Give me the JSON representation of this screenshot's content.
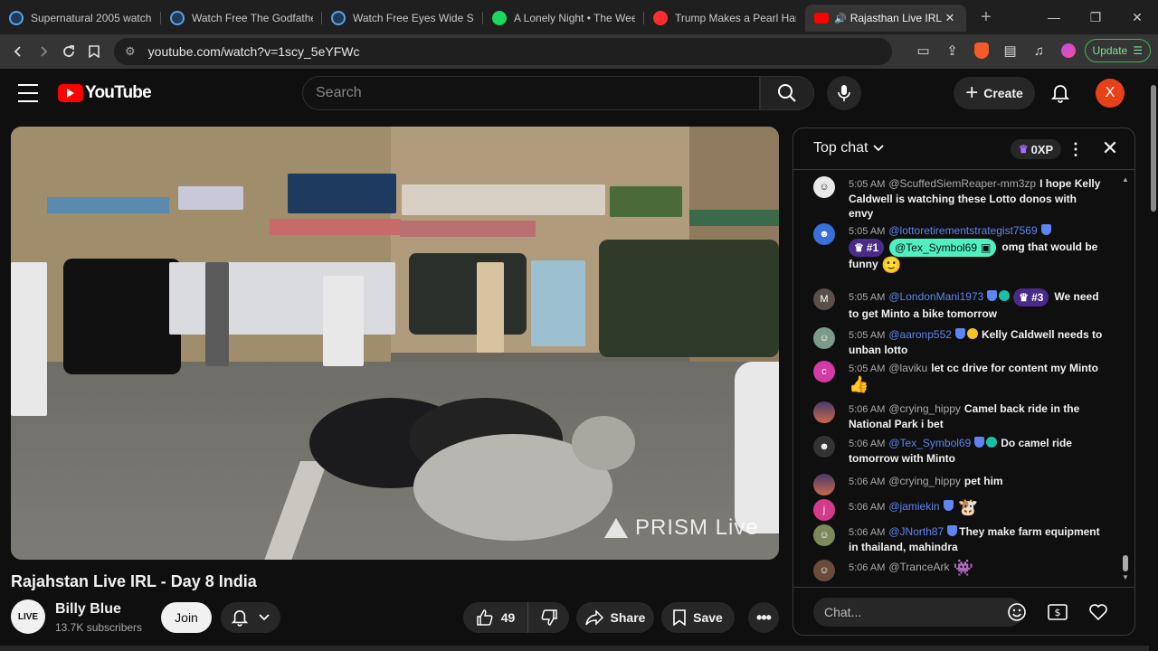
{
  "browser": {
    "tabs": [
      {
        "title": "Supernatural 2005 watch f",
        "favicon": "site-icon",
        "active": false
      },
      {
        "title": "Watch Free The Godfather",
        "favicon": "site-icon",
        "active": false
      },
      {
        "title": "Watch Free Eyes Wide Shu",
        "favicon": "site-icon",
        "active": false
      },
      {
        "title": "A Lonely Night • The Week",
        "favicon": "spotify-icon",
        "active": false
      },
      {
        "title": "Trump Makes a Pearl Harb",
        "favicon": "youtube-icon",
        "active": false
      },
      {
        "title": "Rajasthan Live IRL -",
        "favicon": "youtube-icon",
        "active": true
      }
    ],
    "url": "youtube.com/watch?v=1scy_5eYFWc",
    "update_label": "Update"
  },
  "youtube": {
    "logo_text": "YouTube",
    "search_placeholder": "Search",
    "create_label": "Create",
    "avatar_letter": "X"
  },
  "video": {
    "watermark": "PRISM Live",
    "title": "Rajahstan Live IRL - Day 8 India",
    "channel": "Billy Blue",
    "channel_avatar_text": "LIVE",
    "subscribers": "13.7K subscribers",
    "join_label": "Join",
    "likes": "49",
    "share_label": "Share",
    "save_label": "Save"
  },
  "chat": {
    "header": "Top chat",
    "xp": "0XP",
    "input_placeholder": "Chat...",
    "messages": [
      {
        "time": "5:05 AM",
        "author": "@ScuffedSiemReaper-mm3zp",
        "text": "I hope Kelly Caldwell is watching these Lotto donos with envy",
        "avatar_color": "#e8e8e8"
      },
      {
        "time": "5:05 AM",
        "author": "@lottoretirementstrategist7569",
        "rank": "#1",
        "mention": "@Tex_Symbol69",
        "text": "omg that would be funny",
        "emoji": "🙂",
        "avatar_color": "#3a6fd8"
      },
      {
        "time": "5:05 AM",
        "author": "@LondonMani1973",
        "rank": "#3",
        "text": "We need to get Minto a bike tomorrow",
        "avatar_letter": "M",
        "avatar_color": "#5a4f4a"
      },
      {
        "time": "5:05 AM",
        "author": "@aaronp552",
        "text": "Kelly Caldwell needs to unban lotto",
        "avatar_color": "#7a9a8a"
      },
      {
        "time": "5:05 AM",
        "author": "@laviku",
        "text": "let cc drive for content my Minto",
        "emoji": "👍",
        "avatar_letter": "c",
        "avatar_color": "#d43aa5"
      },
      {
        "time": "5:06 AM",
        "author": "@crying_hippy",
        "text": "Camel back ride in the National Park i bet",
        "avatar_color": "#8a6a9a"
      },
      {
        "time": "5:06 AM",
        "author": "@Tex_Symbol69",
        "text": "Do camel ride tomorrow with Minto",
        "avatar_color": "#333333"
      },
      {
        "time": "5:06 AM",
        "author": "@crying_hippy",
        "text": "pet him",
        "avatar_color": "#8a6a9a"
      },
      {
        "time": "5:06 AM",
        "author": "@jamiekin",
        "text": "",
        "emoji": "🐮",
        "avatar_letter": "j",
        "avatar_color": "#d43a8a"
      },
      {
        "time": "5:06 AM",
        "author": "@JNorth87",
        "text": "They make farm equipment in thailand, mahindra",
        "avatar_color": "#7a8a5a"
      },
      {
        "time": "5:06 AM",
        "author": "@TranceArk",
        "text": "",
        "emoji": "👾",
        "avatar_color": "#6a4a3a"
      }
    ]
  },
  "colors": {
    "youtube_red": "#ff0000",
    "chat_mod_blue": "#5e84f1",
    "avatar_orange": "#e8411a"
  }
}
